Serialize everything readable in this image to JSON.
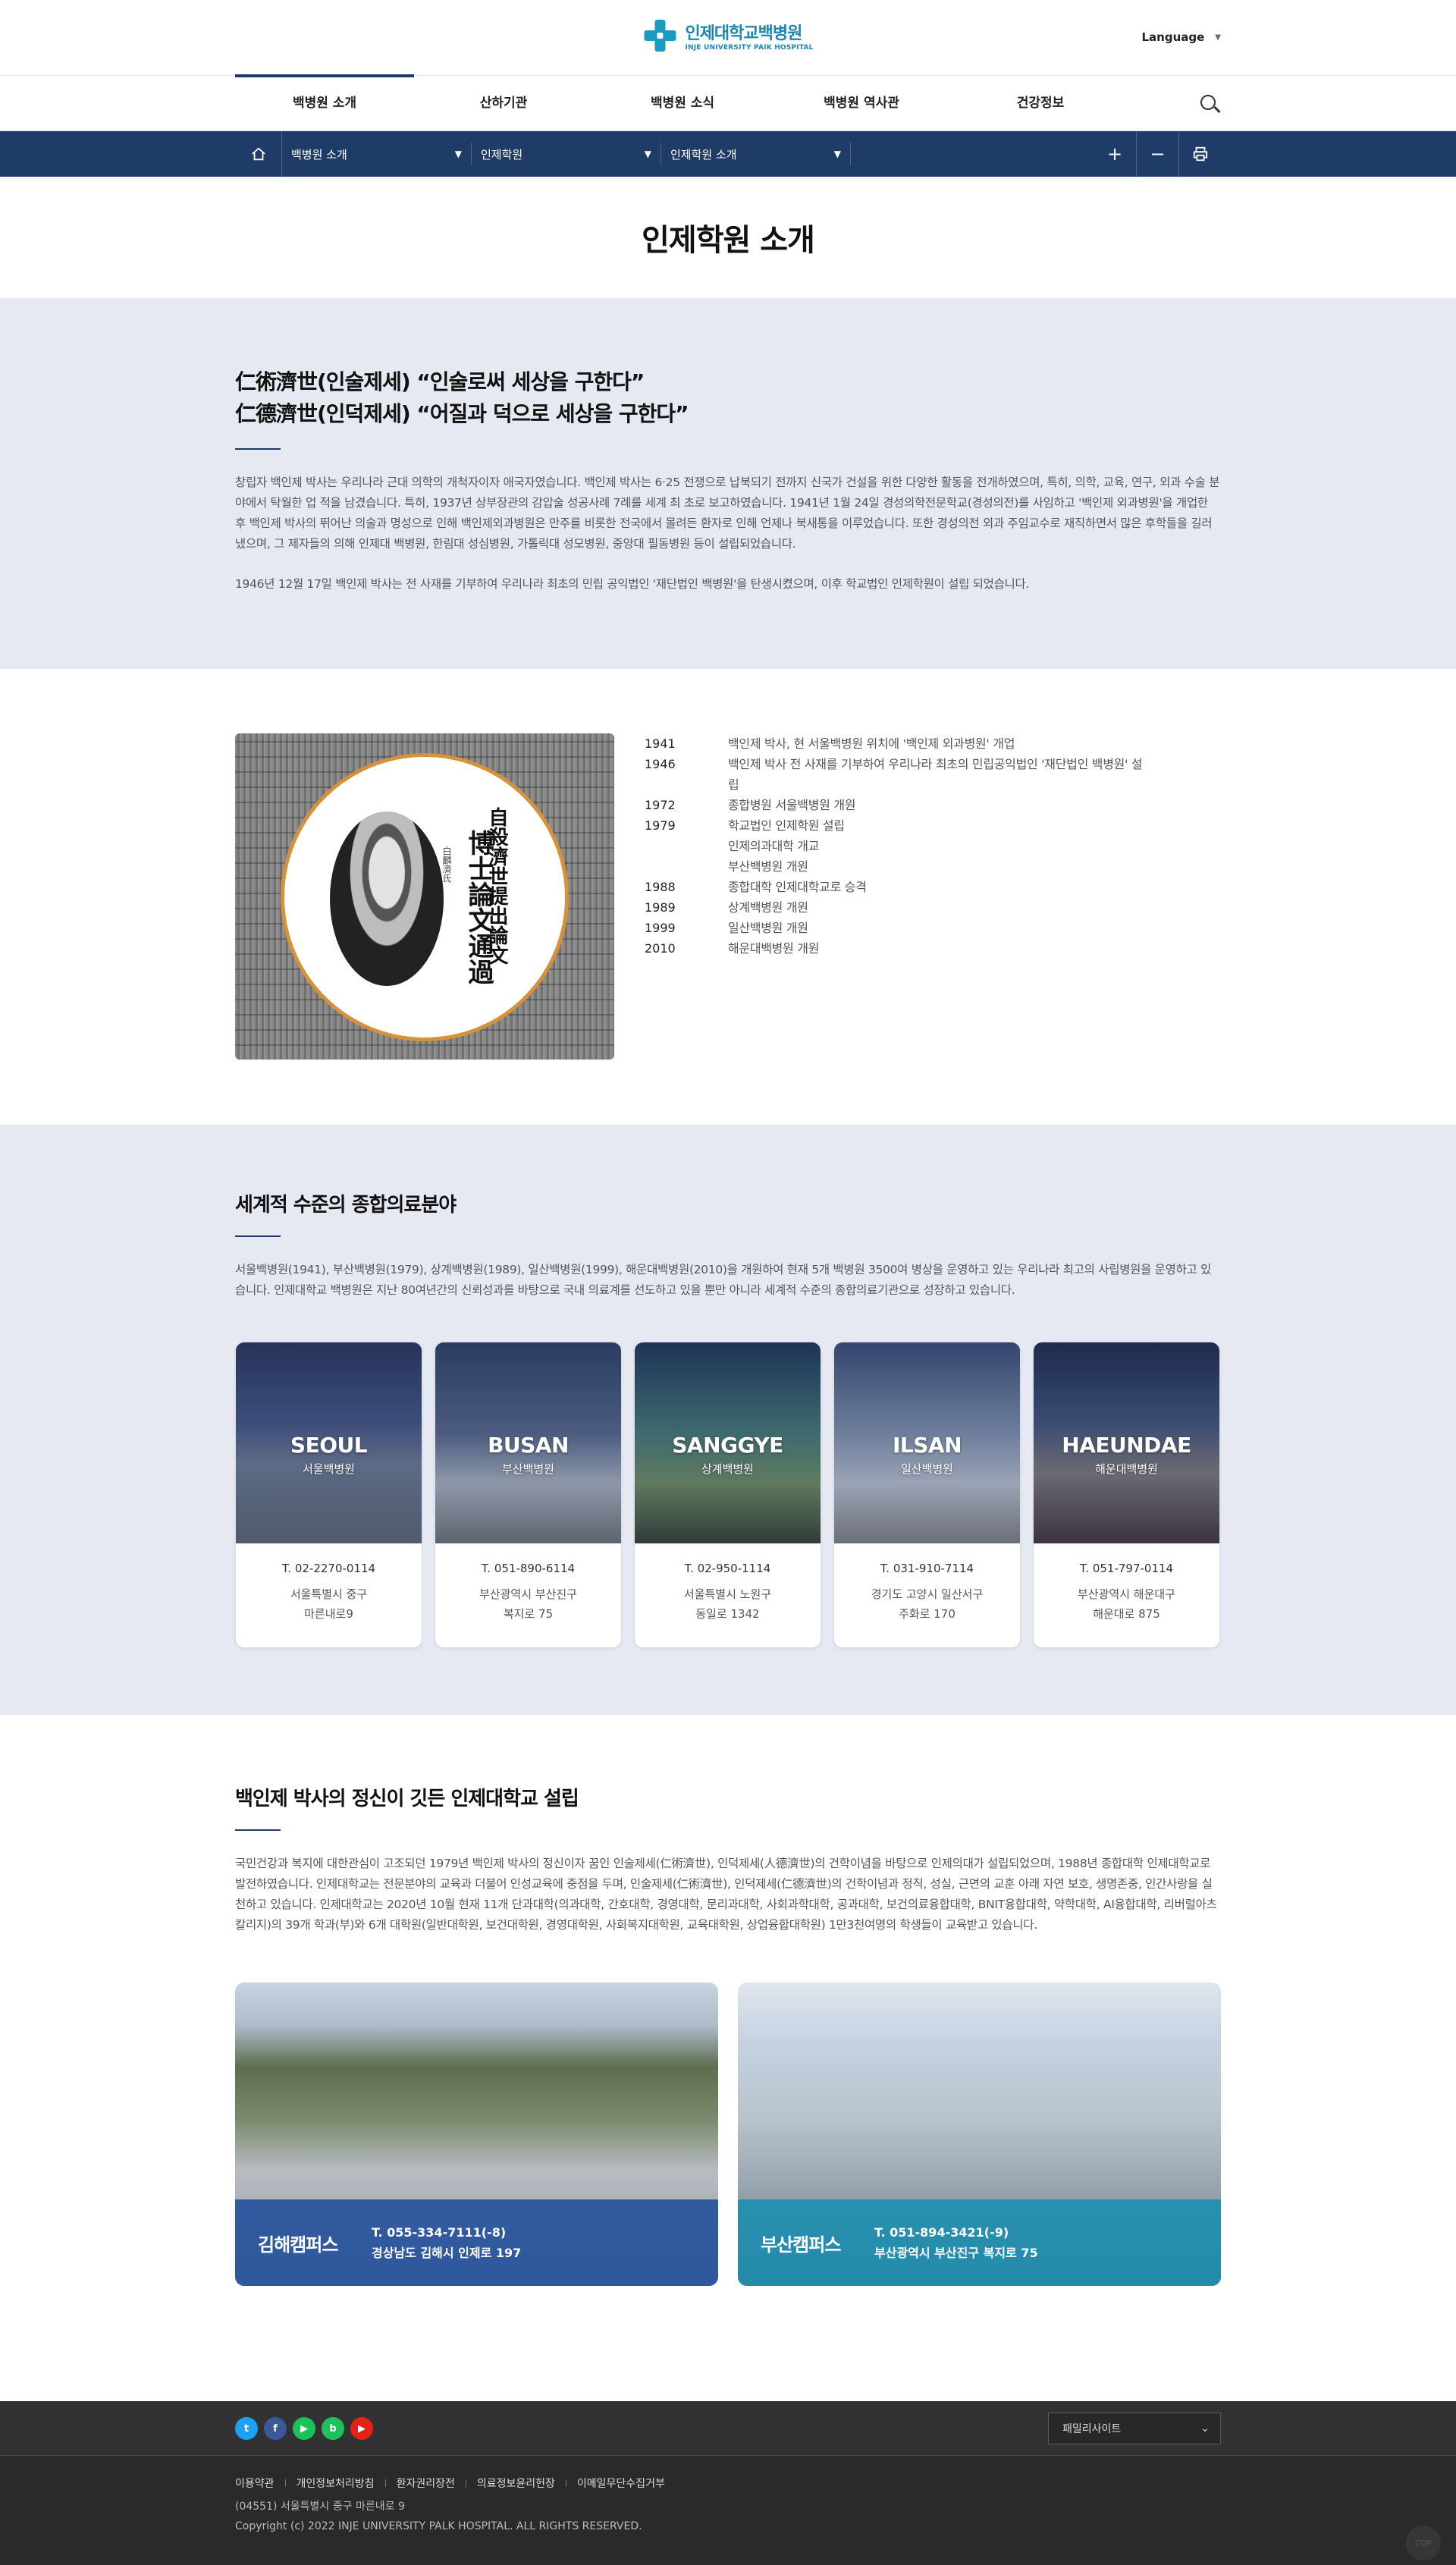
{
  "header": {
    "logo_ko": "인제대학교백병원",
    "logo_en": "INJE UNIVERSITY PAIK HOSPITAL",
    "language": "Language"
  },
  "gnb": [
    "백병원 소개",
    "산하기관",
    "백병원 소식",
    "백병원 역사관",
    "건강정보"
  ],
  "breadcrumb": {
    "items": [
      "백병원 소개",
      "인제학원",
      "인제학원 소개"
    ],
    "tools": {
      "zoom_in": "+",
      "zoom_out": "−"
    }
  },
  "page_title": "인제학원 소개",
  "intro": {
    "quote1": "仁術濟世(인술제세) “인술로써 세상을 구한다”",
    "quote2": "仁德濟世(인덕제세) “어질과 덕으로 세상을 구한다”",
    "para1": "창립자 백인제 박사는 우리나라 근대 의학의 개척자이자 애국자였습니다. 백인제 박사는 6·25 전쟁으로 납북되기 전까지 신국가 건설을 위한 다양한 활동을 전개하였으며, 특히, 의학, 교육, 연구, 외과 수술 분야에서 탁월한 업 적을 남겼습니다. 특히, 1937년 상부장관의 감압술 성공사례 7례를 세계 최 초로 보고하였습니다. 1941년 1월 24일 경성의학전문학교(경성의전)를 사임하고 '백인제 외과병원'을 개업한 후 백인제 박사의 뛰어난 의술과 명성으로 인해 백인제외과병원은 만주를 비롯한 전국에서 몰려든 환자로 인해 언제나 북새통을 이루었습니다. 또한 경성의전 외과 주임교수로 재직하면서 많은 후학들을 길러냈으며, 그 제자들의 의해 인제대 백병원, 한림대 성심병원, 가톨릭대 성모병원, 중앙대 필동병원 등이 설립되었습니다.",
    "para2": "1946년 12월 17일 백인제 박사는 전 사재를 기부하여 우리나라 최초의 민립 공익법인 '재단법인 백병원'을 탄생시켰으며, 이후 학교법인 인제학원이 설립 되었습니다."
  },
  "history": {
    "image_text": {
      "line1": "自殺濟世提出論文",
      "line2": "博士論文通過",
      "line3": "白麟濟氏"
    },
    "timeline": [
      {
        "year": "1941",
        "text": "백인제 박사, 현 서울백병원 위치에 '백인제 외과병원' 개업"
      },
      {
        "year": "1946",
        "text": "백인제 박사 전 사재를 기부하여 우리나라 최초의 민립공익법인 '재단법인 백병원' 설립"
      },
      {
        "year": "1972",
        "text": "종합병원 서울백병원 개원"
      },
      {
        "year": "1979",
        "text": "학교법인 인제학원 설립"
      },
      {
        "year": "",
        "text": "인제의과대학 개교"
      },
      {
        "year": "",
        "text": "부산백병원 개원"
      },
      {
        "year": "1988",
        "text": "종합대학 인제대학교로 승격"
      },
      {
        "year": "1989",
        "text": "상계백병원 개원"
      },
      {
        "year": "1999",
        "text": "일산백병원 개원"
      },
      {
        "year": "2010",
        "text": "해운대백병원 개원"
      }
    ]
  },
  "hospitals": {
    "title": "세계적 수준의 종합의료분야",
    "desc": "서울백병원(1941), 부산백병원(1979), 상계백병원(1989), 일산백병원(1999), 해운대백병원(2010)을 개원하여 현재 5개 백병원 3500여 병상을 운영하고 있는 우리나라 최고의 사립병원을 운영하고 있습니다. 인제대학교 백병원은 지난 80여년간의 신뢰성과를 바탕으로 국내 의료계를 선도하고 있을 뿐만 아니라 세계적 수준의 종합의료기관으로 성장하고 있습니다.",
    "cards": [
      {
        "en": "SEOUL",
        "ko": "서울백병원",
        "tel": "T. 02-2270-0114",
        "addr1": "서울특별시 중구",
        "addr2": "마른내로9"
      },
      {
        "en": "BUSAN",
        "ko": "부산백병원",
        "tel": "T. 051-890-6114",
        "addr1": "부산광역시 부산진구",
        "addr2": "복지로 75"
      },
      {
        "en": "SANGGYE",
        "ko": "상계백병원",
        "tel": "T. 02-950-1114",
        "addr1": "서울특별시 노원구",
        "addr2": "동일로 1342"
      },
      {
        "en": "ILSAN",
        "ko": "일산백병원",
        "tel": "T. 031-910-7114",
        "addr1": "경기도 고양시 일산서구",
        "addr2": "주화로 170"
      },
      {
        "en": "HAEUNDAE",
        "ko": "해운대백병원",
        "tel": "T. 051-797-0114",
        "addr1": "부산광역시 해운대구",
        "addr2": "해운대로 875"
      }
    ]
  },
  "founding": {
    "title": "백인제 박사의 정신이 깃든 인제대학교 설립",
    "desc": "국민건강과 복지에 대한관심이 고조되던 1979년 백인제 박사의 정신이자 꿈인 인술제세(仁術濟世), 인덕제세(人德濟世)의 건학이념을 바탕으로 인제의대가 설립되었으며, 1988년 종합대학 인제대학교로 발전하였습니다. 인제대학교는 전문분야의 교육과 더불어 인성교육에 중점을 두며, 인술제세(仁術濟世), 인덕제세(仁德濟世)의 건학이념과 정직, 성실, 근면의 교훈 아래 자연 보호, 생명존중, 인간사랑을 실천하고 있습니다. 인제대학교는 2020년 10월 현재 11개 단과대학(의과대학, 간호대학, 경영대학, 문리과대학, 사회과학대학, 공과대학, 보건의료융합대학, BNIT융합대학, 약학대학, AI융합대학, 리버럴아츠칼리지)의 39개 학과(부)와 6개 대학원(일반대학원, 보건대학원, 경영대학원, 사회복지대학원, 교육대학원, 상업융합대학원) 1만3천여명의 학생들이 교육받고 있습니다.",
    "campuses": [
      {
        "name": "김해캠퍼스",
        "tel": "T. 055-334-7111(-8)",
        "addr": "경상남도 김해시 인제로 197"
      },
      {
        "name": "부산캠퍼스",
        "tel": "T. 051-894-3421(-9)",
        "addr": "부산광역시 부산진구 복지로 75"
      }
    ]
  },
  "footer": {
    "sns": [
      {
        "icon": "twitter-icon",
        "glyph": "t",
        "color": "#1da1f2"
      },
      {
        "icon": "facebook-icon",
        "glyph": "f",
        "color": "#3b5998"
      },
      {
        "icon": "naver-tv-icon",
        "glyph": "▶",
        "color": "#19c35a"
      },
      {
        "icon": "blog-icon",
        "glyph": "b",
        "color": "#20c05c"
      },
      {
        "icon": "youtube-icon",
        "glyph": "▶",
        "color": "#e62117"
      }
    ],
    "family_site": "패밀리사이트",
    "links": [
      "이용약관",
      "개인정보처리방침",
      "환자권리장전",
      "의료정보윤리헌장",
      "이메일무단수집거부"
    ],
    "address": "(04551) 서울특별시 중구 마른내로 9",
    "copyright": "Copyright (c) 2022 INJE UNIVERSITY PALK HOSPITAL. ALL RIGHTS RESERVED.",
    "top": "TOP"
  }
}
